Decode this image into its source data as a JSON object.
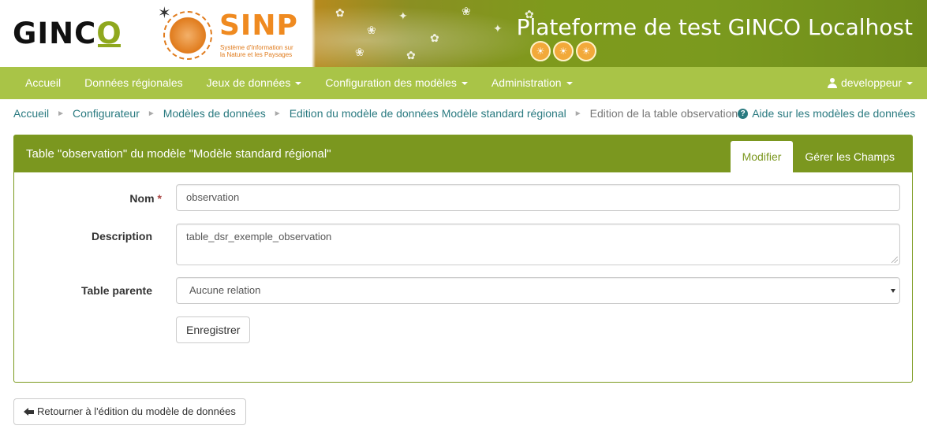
{
  "header": {
    "logo_text": "GINCO",
    "sinp_title": "SINP",
    "sinp_subtitle": "Système d'Information sur la Nature et les Paysages",
    "platform_title": "Plateforme de test GINCO Localhost"
  },
  "navbar": {
    "items": [
      {
        "label": "Accueil",
        "dropdown": false
      },
      {
        "label": "Données régionales",
        "dropdown": false
      },
      {
        "label": "Jeux de données",
        "dropdown": true
      },
      {
        "label": "Configuration des modèles",
        "dropdown": true
      },
      {
        "label": "Administration",
        "dropdown": true
      }
    ],
    "user": "developpeur",
    "user_icon": "user-icon"
  },
  "breadcrumb": {
    "items": [
      "Accueil",
      "Configurateur",
      "Modèles de données",
      "Edition du modèle de données Modèle standard régional"
    ],
    "current": "Edition de la table observation",
    "help_label": "Aide sur les modèles de données",
    "help_icon": "question-circle-icon"
  },
  "panel": {
    "title": "Table \"observation\" du modèle \"Modèle standard régional\"",
    "tabs": [
      {
        "label": "Modifier",
        "active": true
      },
      {
        "label": "Gérer les Champs",
        "active": false
      }
    ]
  },
  "form": {
    "name_label": "Nom",
    "name_required": "*",
    "name_value": "observation",
    "description_label": "Description",
    "description_value": "table_dsr_exemple_observation",
    "parent_label": "Table parente",
    "parent_value": "Aucune relation",
    "save_label": "Enregistrer"
  },
  "back_button": {
    "label": "Retourner à l'édition du modèle de données",
    "icon": "arrow-left-icon"
  },
  "colors": {
    "brand_green": "#a9c447",
    "panel_green": "#7b971f",
    "link": "#2a7a80",
    "sinp_orange": "#ef8a20"
  }
}
